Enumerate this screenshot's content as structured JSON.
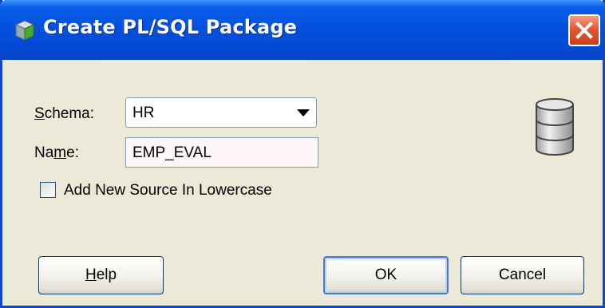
{
  "window": {
    "title": "Create PL/SQL Package",
    "close_label": "Close"
  },
  "form": {
    "schema_label_u": "S",
    "schema_label_rest": "chema:",
    "schema_value": "HR",
    "name_label_pre": "Na",
    "name_label_u": "m",
    "name_label_rest": "e:",
    "name_value": "EMP_EVAL",
    "lowercase_label": "Add New Source In Lowercase",
    "lowercase_checked": false
  },
  "buttons": {
    "help_u": "H",
    "help_rest": "elp",
    "ok": "OK",
    "cancel": "Cancel"
  },
  "icons": {
    "title": "package-icon",
    "close": "close-icon",
    "dropdown": "chevron-down-icon",
    "database": "database-icon"
  },
  "colors": {
    "title_bar": "#0553e0",
    "close_button": "#e2582f",
    "dialog_bg": "#ece9d8",
    "name_field_bg": "#fff7f7"
  }
}
